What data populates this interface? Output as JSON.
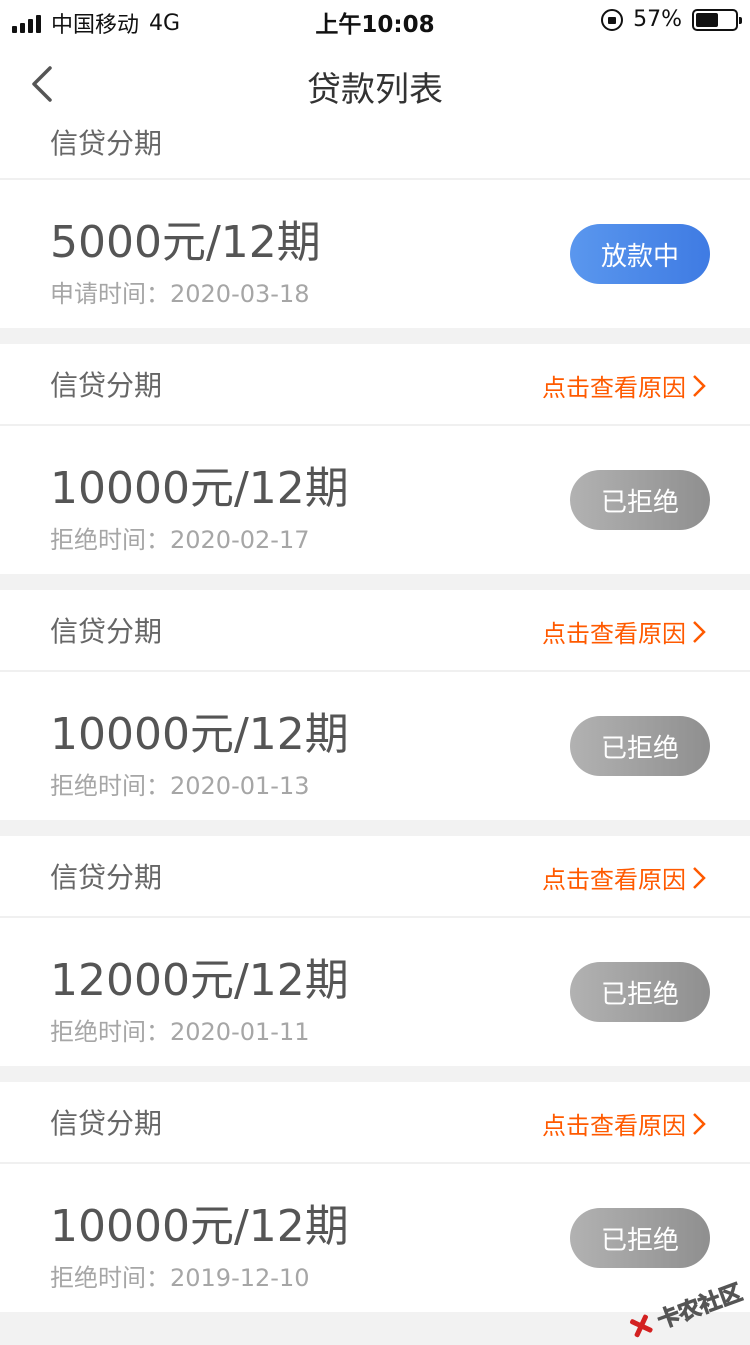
{
  "status_bar": {
    "carrier": "中国移动",
    "network": "4G",
    "time": "上午10:08",
    "battery_percent": "57%",
    "battery_level": 0.57
  },
  "nav": {
    "title": "贷款列表"
  },
  "partial_card": {
    "label": "信贷分期"
  },
  "cards": [
    {
      "label": "",
      "amount": "5000元/12期",
      "date_label": "申请时间：",
      "date": "2020-03-18",
      "status": "放款中",
      "reason_link": ""
    },
    {
      "label": "信贷分期",
      "amount": "10000元/12期",
      "date_label": "拒绝时间：",
      "date": "2020-02-17",
      "status": "已拒绝",
      "reason_link": "点击查看原因"
    },
    {
      "label": "信贷分期",
      "amount": "10000元/12期",
      "date_label": "拒绝时间：",
      "date": "2020-01-13",
      "status": "已拒绝",
      "reason_link": "点击查看原因"
    },
    {
      "label": "信贷分期",
      "amount": "12000元/12期",
      "date_label": "拒绝时间：",
      "date": "2020-01-11",
      "status": "已拒绝",
      "reason_link": "点击查看原因"
    },
    {
      "label": "信贷分期",
      "amount": "10000元/12期",
      "date_label": "拒绝时间：",
      "date": "2019-12-10",
      "status": "已拒绝",
      "reason_link": "点击查看原因"
    }
  ],
  "watermark": {
    "text": "卡农社区"
  },
  "colors": {
    "accent_orange": "#ff5a00",
    "button_blue": "#4a88e8",
    "button_gray": "#a0a0a0",
    "page_bg": "#f2f2f2"
  }
}
